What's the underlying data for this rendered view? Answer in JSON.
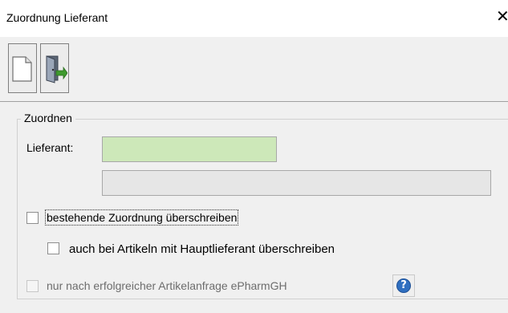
{
  "window": {
    "title": "Zuordnung Lieferant",
    "close_glyph": "✕"
  },
  "toolbar": {
    "buttons": [
      {
        "icon": "new-document-icon"
      },
      {
        "icon": "exit-door-icon"
      }
    ]
  },
  "group": {
    "legend": "Zuordnen",
    "supplier_label": "Lieferant:",
    "supplier_value": "",
    "supplier_name_value": ""
  },
  "checkboxes": {
    "overwrite_existing": {
      "label": "bestehende Zuordnung überschreiben",
      "checked": false
    },
    "overwrite_main_supplier": {
      "label": "auch bei Artikeln mit Hauptlieferant überschreiben",
      "checked": false
    },
    "only_after_request": {
      "label": "nur nach erfolgreicher Artikelanfrage ePharmGH",
      "checked": false,
      "enabled": false
    }
  },
  "help": {
    "glyph": "?"
  },
  "colors": {
    "supplier_field": "#cde8b9",
    "readonly_field": "#e6e6e6",
    "help_blue": "#2f6fc0"
  }
}
